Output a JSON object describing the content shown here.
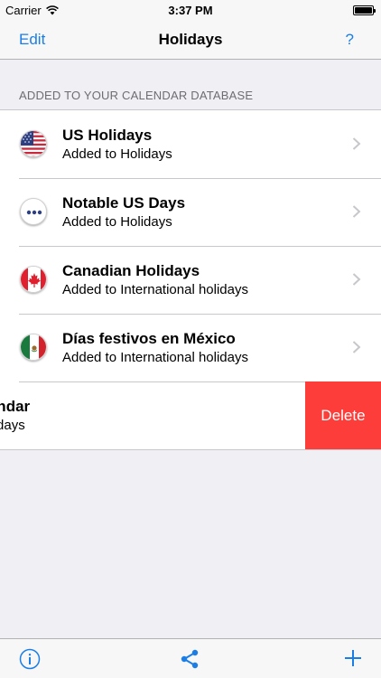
{
  "status_bar": {
    "carrier": "Carrier",
    "time": "3:37 PM"
  },
  "nav": {
    "left_label": "Edit",
    "title": "Holidays",
    "right_label": "?"
  },
  "section": {
    "header": "ADDED TO YOUR CALENDAR DATABASE"
  },
  "calendars": [
    {
      "title": "US Holidays",
      "subtitle": "Added to Holidays",
      "icon": "us-flag-icon"
    },
    {
      "title": "Notable US Days",
      "subtitle": "Added to Holidays",
      "icon": "ellipsis-icon"
    },
    {
      "title": "Canadian Holidays",
      "subtitle": "Added to International holidays",
      "icon": "canada-flag-icon"
    },
    {
      "title": "Días festivos en México",
      "subtitle": "Added to International holidays",
      "icon": "mexico-flag-icon"
    },
    {
      "title": "agan Calendar",
      "subtitle": "dded to Holidays",
      "icon": "none"
    }
  ],
  "delete_label": "Delete",
  "colors": {
    "accent": "#1b7ee6",
    "delete": "#fc3d39",
    "background": "#efeff4"
  },
  "toolbar": {
    "icons": [
      "info-icon",
      "share-icon",
      "plus-icon"
    ]
  }
}
